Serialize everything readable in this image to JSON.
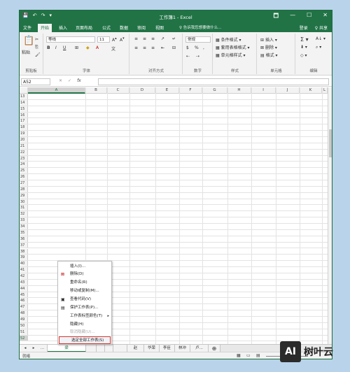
{
  "window": {
    "title": "工作簿1 - Excel",
    "qat": [
      "💾",
      "↶",
      "↷",
      "▾"
    ],
    "controls": [
      "🗖",
      "—",
      "☐",
      "✕"
    ]
  },
  "tabs": [
    {
      "label": "文件"
    },
    {
      "label": "开始"
    },
    {
      "label": "插入"
    },
    {
      "label": "页面布局"
    },
    {
      "label": "公式"
    },
    {
      "label": "数据"
    },
    {
      "label": "审阅"
    },
    {
      "label": "视图"
    }
  ],
  "tell_me": "♀ 告诉我您想要做什么...",
  "login": "登录",
  "share": "♀ 共享",
  "ribbon": {
    "clipboard": {
      "label": "剪贴板",
      "paste": "粘贴"
    },
    "font": {
      "label": "字体",
      "name": "等线",
      "size": "11",
      "buttons": [
        "B",
        "I",
        "U"
      ]
    },
    "alignment": {
      "label": "对齐方式"
    },
    "number": {
      "label": "数字",
      "format": "常规"
    },
    "styles": {
      "label": "样式",
      "items": [
        "条件格式 ▾",
        "套用表格格式 ▾",
        "单元格样式 ▾"
      ]
    },
    "cells": {
      "label": "单元格",
      "items": [
        "插入 ▾",
        "删除 ▾",
        "格式 ▾"
      ]
    },
    "editing": {
      "label": "编辑"
    }
  },
  "name_box": "A52",
  "fx_icons": [
    "✕",
    "✓",
    "fx"
  ],
  "columns": [
    "A",
    "B",
    "C",
    "D",
    "E",
    "F",
    "G",
    "H",
    "I",
    "J",
    "K",
    "L"
  ],
  "rows": [
    "13",
    "14",
    "15",
    "16",
    "17",
    "18",
    "19",
    "20",
    "21",
    "22",
    "23",
    "24",
    "25",
    "26",
    "27",
    "28",
    "29",
    "30",
    "31",
    "32",
    "33",
    "34",
    "35",
    "36",
    "37",
    "38",
    "39",
    "40",
    "41",
    "42",
    "43",
    "44",
    "45",
    "46",
    "47",
    "48",
    "49",
    "50",
    "51",
    "52"
  ],
  "context_menu": [
    {
      "label": "插入(I)...",
      "icon": "",
      "disabled": false,
      "arrow": false,
      "highlight": false
    },
    {
      "label": "删除(D)",
      "icon": "⊠",
      "disabled": false,
      "arrow": false,
      "highlight": false
    },
    {
      "label": "重命名(R)",
      "icon": "",
      "disabled": false,
      "arrow": false,
      "highlight": false
    },
    {
      "label": "移动或复制(M)...",
      "icon": "",
      "disabled": false,
      "arrow": false,
      "highlight": false
    },
    {
      "label": "查看代码(V)",
      "icon": "▣",
      "disabled": false,
      "arrow": false,
      "highlight": false
    },
    {
      "label": "保护工作表(P)...",
      "icon": "▤",
      "disabled": false,
      "arrow": false,
      "highlight": false
    },
    {
      "label": "工作表标签颜色(T)",
      "icon": "",
      "disabled": false,
      "arrow": true,
      "highlight": false
    },
    {
      "label": "隐藏(H)",
      "icon": "",
      "disabled": false,
      "arrow": false,
      "highlight": false
    },
    {
      "label": "取消隐藏(U)...",
      "icon": "",
      "disabled": true,
      "arrow": false,
      "highlight": false
    },
    {
      "label": "选定全部工作表(S)",
      "icon": "",
      "disabled": false,
      "arrow": false,
      "highlight": true
    }
  ],
  "sheet_tabs": [
    "...",
    "梁",
    "",
    "",
    "",
    "",
    "赵",
    "华荣",
    "李臣",
    "林冲",
    "卢..."
  ],
  "sheet_nav": [
    "◂",
    "▸"
  ],
  "status": {
    "ready": "就绪"
  },
  "logo": {
    "mark": "AI",
    "text": "树叶云"
  },
  "colors": {
    "accent": "#217346",
    "highlight_border": "#d9342b"
  }
}
